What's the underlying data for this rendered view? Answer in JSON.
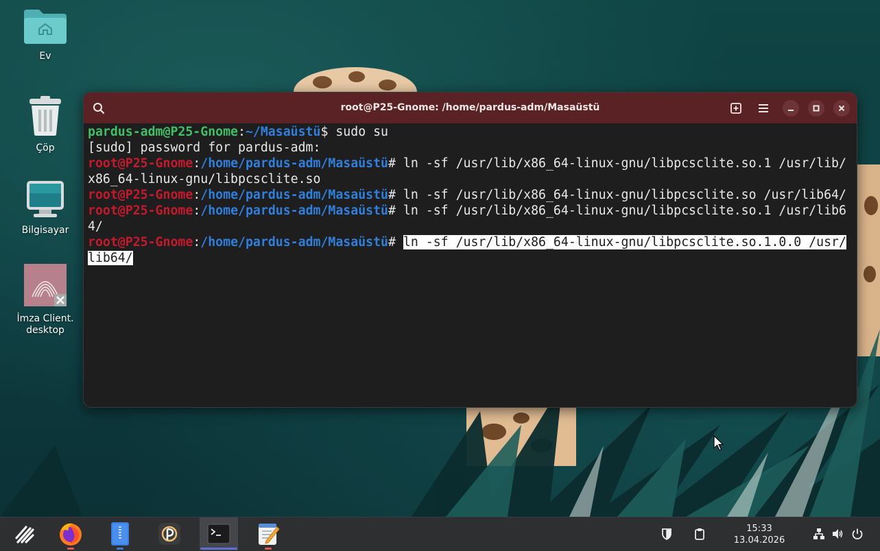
{
  "desktop": {
    "icons": [
      {
        "label": "Ev",
        "icon": "home-folder-icon"
      },
      {
        "label": "Çöp",
        "icon": "trash-icon"
      },
      {
        "label": "Bilgisayar",
        "icon": "computer-icon"
      },
      {
        "label_line1": "İmza Client.",
        "label_line2": "desktop",
        "icon": "desktop-file-icon"
      }
    ]
  },
  "terminal": {
    "title": "root@P25-Gnome: /home/pardus-adm/Masaüstü",
    "lines": [
      {
        "user": "pardus-adm@P25-Gnome",
        "sep": ":",
        "path": "~/Masaüstü",
        "sym": "$ ",
        "cmd": "sudo su"
      },
      {
        "text": "[sudo] password for pardus-adm:"
      },
      {
        "user": "root@P25-Gnome",
        "sep": ":",
        "path": "/home/pardus-adm/Masaüstü",
        "sym": "# ",
        "cmd": "ln -sf /usr/lib/x86_64-linux-gnu/libpcsclite.so.1 /usr/lib/"
      },
      {
        "text": "x86_64-linux-gnu/libpcsclite.so"
      },
      {
        "user": "root@P25-Gnome",
        "sep": ":",
        "path": "/home/pardus-adm/Masaüstü",
        "sym": "# ",
        "cmd": "ln -sf /usr/lib/x86_64-linux-gnu/libpcsclite.so /usr/lib64/"
      },
      {
        "user": "root@P25-Gnome",
        "sep": ":",
        "path": "/home/pardus-adm/Masaüstü",
        "sym": "# ",
        "cmd": "ln -sf /usr/lib/x86_64-linux-gnu/libpcsclite.so.1 /usr/lib6"
      },
      {
        "text": "4/"
      },
      {
        "user": "root@P25-Gnome",
        "sep": ":",
        "path": "/home/pardus-adm/Masaüstü",
        "sym": "# ",
        "cmd_selected": "ln -sf /usr/lib/x86_64-linux-gnu/libpcsclite.so.1.0.0 /usr/"
      },
      {
        "text_selected": "lib64/"
      }
    ]
  },
  "taskbar": {
    "apps": [
      {
        "icon": "pardus-menu-icon"
      },
      {
        "icon": "firefox-icon"
      },
      {
        "icon": "file-manager-icon"
      },
      {
        "icon": "pardus-app-icon"
      },
      {
        "icon": "terminal-icon"
      },
      {
        "icon": "text-editor-icon"
      }
    ],
    "clock_time": "15:33",
    "clock_date": "13.04.2026",
    "tray": [
      "shield-icon",
      "clipboard-icon",
      "network-icon",
      "volume-icon",
      "power-icon"
    ]
  },
  "colors": {
    "titlebar": "#5b2225",
    "terminal_bg": "#1e1e1e",
    "prompt_user": "#3fbf66",
    "prompt_root": "#c51a2c",
    "prompt_path": "#2f7fdc",
    "taskbar": "#2e2f30"
  }
}
